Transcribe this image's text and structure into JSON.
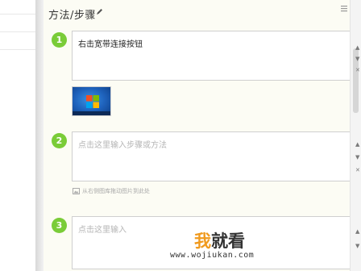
{
  "header": {
    "title": "方法/步骤"
  },
  "steps": [
    {
      "number": "1",
      "text": "右击宽带连接按钮"
    },
    {
      "number": "2",
      "placeholder": "点击这里输入步骤或方法",
      "upload_hint": "从右侧图库拖动图片到此处"
    },
    {
      "number": "3",
      "placeholder": "点击这里输入"
    }
  ],
  "watermark": {
    "brand_char1": "我",
    "brand_rest": "就看",
    "url": "www.wojiukan.com"
  },
  "colors": {
    "step_badge": "#7acc38",
    "panel_bg": "#fcfcf4",
    "brand_orange": "#f09a1e"
  }
}
